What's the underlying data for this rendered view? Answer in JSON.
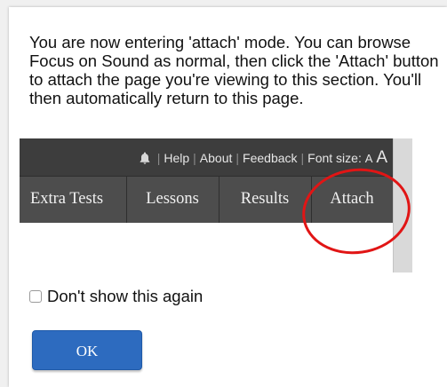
{
  "dialog": {
    "message": "You are now entering 'attach' mode. You can browse Focus on Sound as normal, then click the 'Attach' button to attach the page you're viewing to this section. You'll then automatically return to this page.",
    "checkbox_label": "Don't show this again",
    "checkbox_checked": false,
    "ok_label": "OK"
  },
  "example_screenshot": {
    "top_links": [
      "Help",
      "About",
      "Feedback"
    ],
    "font_size_label": "Font size:",
    "font_small": "A",
    "font_large": "A",
    "bell_icon": "bell-icon",
    "tabs": [
      "Extra Tests",
      "Lessons",
      "Results",
      "Attach"
    ],
    "highlight_color": "#e11515"
  },
  "colors": {
    "ok_button": "#2d6bbf",
    "nav_bar": "#4d4d4d",
    "top_bar": "#3d3d3d"
  }
}
